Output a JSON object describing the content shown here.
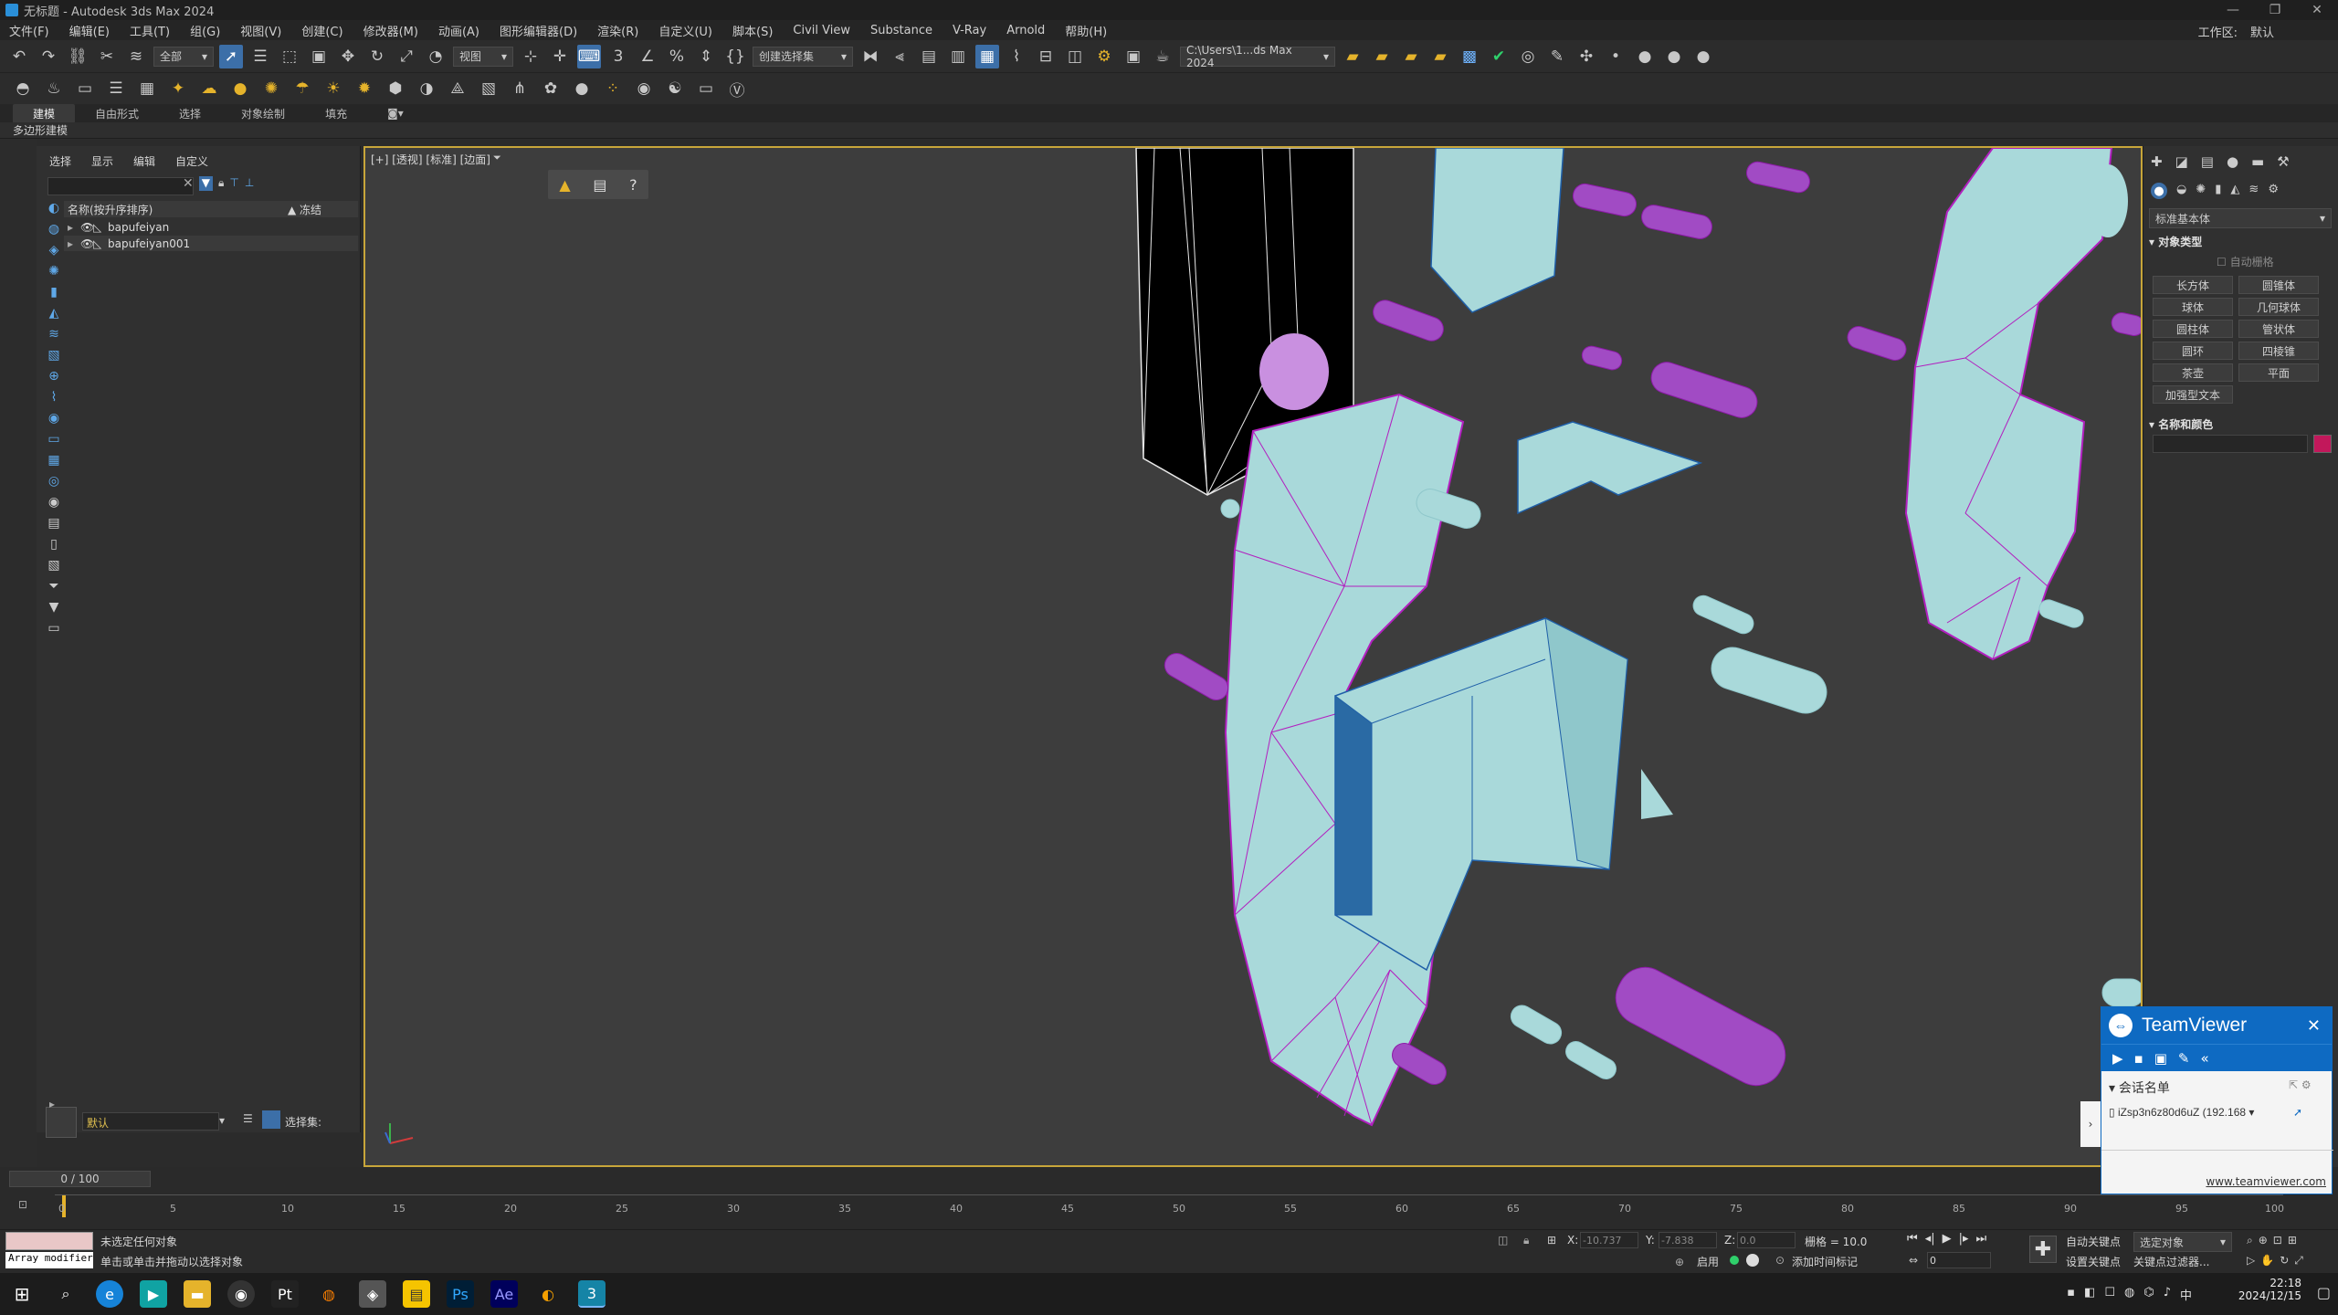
{
  "window": {
    "title": "无标题 - Autodesk 3ds Max 2024",
    "controls": [
      "—",
      "❐",
      "✕"
    ]
  },
  "menu": {
    "items": [
      "文件(F)",
      "编辑(E)",
      "工具(T)",
      "组(G)",
      "视图(V)",
      "创建(C)",
      "修改器(M)",
      "动画(A)",
      "图形编辑器(D)",
      "渲染(R)",
      "自定义(U)",
      "脚本(S)",
      "Civil View",
      "Substance",
      "V-Ray",
      "Arnold",
      "帮助(H)"
    ],
    "workspace_label": "工作区:",
    "workspace_value": "默认"
  },
  "toolbar": {
    "filter_dropdown": "全部",
    "refcoord_dropdown": "视图",
    "selection_set_dropdown": "创建选择集",
    "path_field": "C:\\Users\\1...ds Max 2024"
  },
  "ribbon": {
    "tabs": [
      "建模",
      "自由形式",
      "选择",
      "对象绘制",
      "填充"
    ],
    "selected": "建模",
    "sub_label": "多边形建模"
  },
  "scene_explorer": {
    "tabs": [
      "选择",
      "显示",
      "编辑",
      "自定义"
    ],
    "column_name": "名称(按升序排序)",
    "column_frozen": "▲ 冻结",
    "rows": [
      "bapufeiyan",
      "bapufeiyan001"
    ],
    "layer_label": "默认",
    "selection_set_label": "选择集:"
  },
  "viewport": {
    "label": "[+] [透视] [标准] [边面]"
  },
  "command_panel": {
    "category_dropdown": "标准基本体",
    "rollout_object_type": "对象类型",
    "autogrid_label": "自动栅格",
    "buttons": [
      "长方体",
      "圆锥体",
      "球体",
      "几何球体",
      "圆柱体",
      "管状体",
      "圆环",
      "四棱锥",
      "茶壶",
      "平面",
      "加强型文本"
    ],
    "rollout_name_color": "名称和颜色",
    "object_color": "#c2185b"
  },
  "timeline": {
    "frame_readout": "0 / 100",
    "ticks": [
      "0",
      "5",
      "10",
      "15",
      "20",
      "25",
      "30",
      "35",
      "40",
      "45",
      "50",
      "55",
      "60",
      "65",
      "70",
      "75",
      "80",
      "85",
      "90",
      "95",
      "100"
    ]
  },
  "status": {
    "maxscript_label": "Array modifier",
    "line1": "未选定任何对象",
    "line2": "单击或单击并拖动以选择对象",
    "x_label": "X:",
    "x_value": "-10.737",
    "y_label": "Y:",
    "y_value": "-7.838",
    "z_label": "Z:",
    "z_value": "0.0",
    "grid_label": "栅格 = 10.0",
    "enable_label": "启用",
    "add_time_tag": "添加时间标记",
    "auto_key": "自动关键点",
    "set_key": "设置关键点",
    "key_filter": "关键点过滤器...",
    "selected_object_dropdown": "选定对象",
    "frame_field": "0"
  },
  "teamviewer": {
    "title": "TeamViewer",
    "session_list": "会话名单",
    "session_item": "iZsp3n6z80d6uZ (192.168",
    "link": "www.teamviewer.com"
  },
  "taskbar": {
    "time": "22:18",
    "date": "2024/12/15",
    "apps": [
      "start",
      "search",
      "edge",
      "app",
      "explorer",
      "obs",
      "pycharm",
      "blender",
      "app",
      "notes",
      "photoshop",
      "aftereffects",
      "app",
      "3dsmax"
    ]
  },
  "colors": {
    "viewport_border": "#c8a63a",
    "mesh_fill": "#a8d8d8",
    "wire_magenta": "#b21fbf",
    "accent": "#3c6fa8"
  }
}
